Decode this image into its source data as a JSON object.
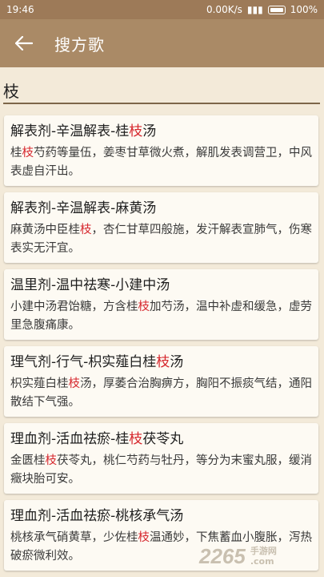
{
  "status_bar": {
    "time": "19:46",
    "speed": "0.00K/s",
    "battery": "100%"
  },
  "toolbar": {
    "title": "搜方歌"
  },
  "search": {
    "value": "枝"
  },
  "results": [
    {
      "title_parts": [
        "解表剂-辛温解表-桂",
        "枝",
        "汤"
      ],
      "body_parts": [
        "桂",
        "枝",
        "芍药等量伍，姜枣甘草微火煮，解肌发表调营卫，中风表虚自汗出。"
      ]
    },
    {
      "title_parts": [
        "解表剂-辛温解表-麻黄汤"
      ],
      "body_parts": [
        "麻黄汤中臣桂",
        "枝",
        "，杏仁甘草四般施，发汗解表宣肺气，伤寒表实无汗宜。"
      ]
    },
    {
      "title_parts": [
        "温里剂-温中祛寒-小建中汤"
      ],
      "body_parts": [
        "小建中汤君饴糖，方含桂",
        "枝",
        "加芍汤，温中补虚和缓急，虚劳里急腹痛康。"
      ]
    },
    {
      "title_parts": [
        "理气剂-行气-枳实薤白桂",
        "枝",
        "汤"
      ],
      "body_parts": [
        "枳实薤白桂",
        "枝",
        "汤，厚萎合治胸痹方，胸阳不振痰气结，通阳散结下气强。"
      ]
    },
    {
      "title_parts": [
        "理血剂-活血祛瘀-桂",
        "枝",
        "茯苓丸"
      ],
      "body_parts": [
        "金匮桂",
        "枝",
        "茯苓丸，桃仁芍药与牡丹，等分为末蜜丸服，缓消癥块胎可安。"
      ]
    },
    {
      "title_parts": [
        "理血剂-活血祛瘀-桃核承气汤"
      ],
      "body_parts": [
        "桃核承气硝黄草，少佐桂",
        "枝",
        "温通妙，下焦蓄血小腹胀，泻热破瘀微利效。"
      ]
    }
  ],
  "watermark": {
    "logo": "2265",
    "text1": "手游网",
    "text2": ".com"
  },
  "colors": {
    "status_bar": "#9d7a58",
    "toolbar": "#aa8a66",
    "background": "#f3ead9",
    "highlight": "#d6262c"
  }
}
